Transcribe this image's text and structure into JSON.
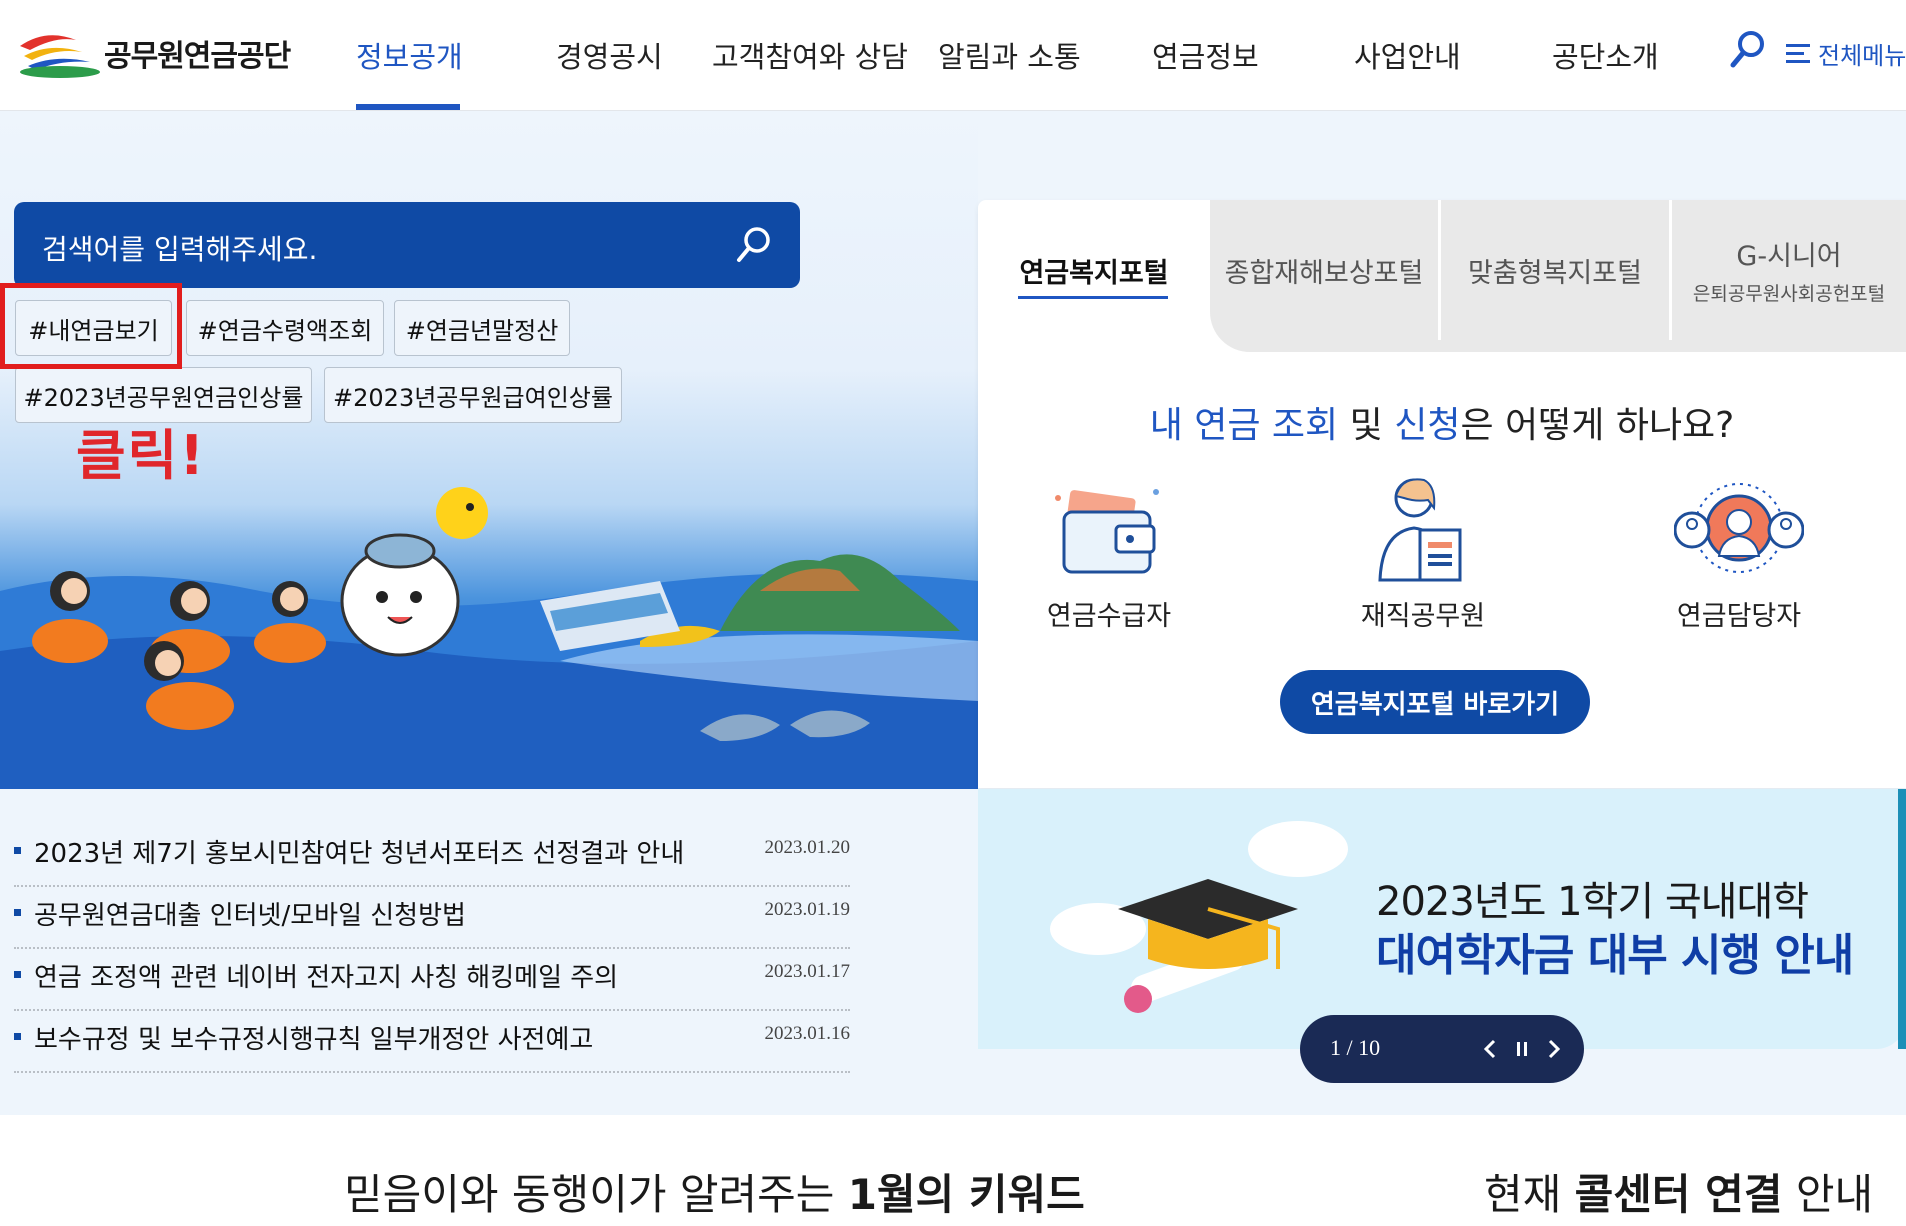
{
  "header": {
    "logo_text": "공무원연금공단",
    "nav": [
      "정보공개",
      "경영공시",
      "고객참여와 상담",
      "알림과 소통",
      "연금정보",
      "사업안내",
      "공단소개"
    ],
    "active_nav": "정보공개",
    "all_menu": "전체메뉴",
    "accent": "#1f56c2"
  },
  "search": {
    "placeholder": "검색어를 입력해주세요."
  },
  "tags": [
    "#내연금보기",
    "#연금수령액조회",
    "#연금년말정산",
    "#2023년공무원연금인상률",
    "#2023년공무원급여인상률"
  ],
  "annotation": {
    "click_text": "클릭!",
    "color": "#e0262b"
  },
  "portal": {
    "tabs": [
      {
        "label": "연금복지포털",
        "sub": ""
      },
      {
        "label": "종합재해보상포털",
        "sub": ""
      },
      {
        "label": "맞춤형복지포털",
        "sub": ""
      },
      {
        "label": "G-시니어",
        "sub": "은퇴공무원사회공헌포털"
      }
    ],
    "question": {
      "p1": "내 연금 조회",
      "p2": " 및 ",
      "p3": "신청",
      "p4": "은 어떻게 하나요?"
    },
    "services": [
      "연금수급자",
      "재직공무원",
      "연금담당자"
    ],
    "button": "연금복지포털 바로가기"
  },
  "news": [
    {
      "title": "2023년 제7기 홍보시민참여단 청년서포터즈 선정결과 안내",
      "date": "2023.01.20"
    },
    {
      "title": "공무원연금대출 인터넷/모바일 신청방법",
      "date": "2023.01.19"
    },
    {
      "title": "연금 조정액 관련 네이버 전자고지 사칭 해킹메일 주의",
      "date": "2023.01.17"
    },
    {
      "title": "보수규정 및 보수규정시행규칙 일부개정안 사전예고",
      "date": "2023.01.16"
    }
  ],
  "banner": {
    "line1": "2023년도 1학기 국내대학",
    "line2": "대여학자금 대부 시행 안내",
    "counter": "1 / 10"
  },
  "bottom": {
    "left_pre": "믿음이와 동행이가 알려주는 ",
    "left_bold": "1월의 키워드",
    "right_pre": "현재 ",
    "right_bold": "콜센터 연결",
    "right_post": " 안내"
  }
}
